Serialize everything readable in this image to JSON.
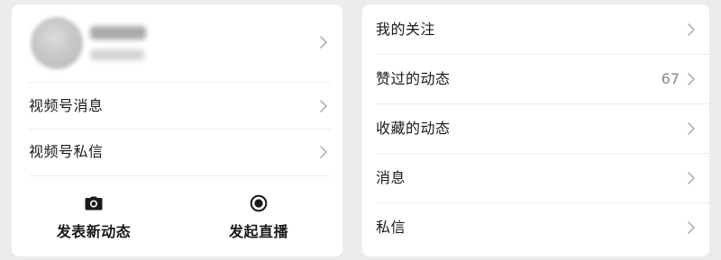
{
  "left_card": {
    "menu": [
      {
        "label": "视频号消息"
      },
      {
        "label": "视频号私信"
      }
    ],
    "actions": [
      {
        "label": "发表新动态",
        "icon": "camera-icon"
      },
      {
        "label": "发起直播",
        "icon": "live-record-icon"
      }
    ]
  },
  "right_card": {
    "menu": [
      {
        "label": "我的关注",
        "count": ""
      },
      {
        "label": "赞过的动态",
        "count": "67"
      },
      {
        "label": "收藏的动态",
        "count": ""
      },
      {
        "label": "消息",
        "count": ""
      },
      {
        "label": "私信",
        "count": ""
      }
    ]
  },
  "colors": {
    "background": "#ececec",
    "card": "#ffffff",
    "text": "#1a1a1a",
    "muted": "#8a8a8a",
    "chevron": "#b3b3b3"
  }
}
